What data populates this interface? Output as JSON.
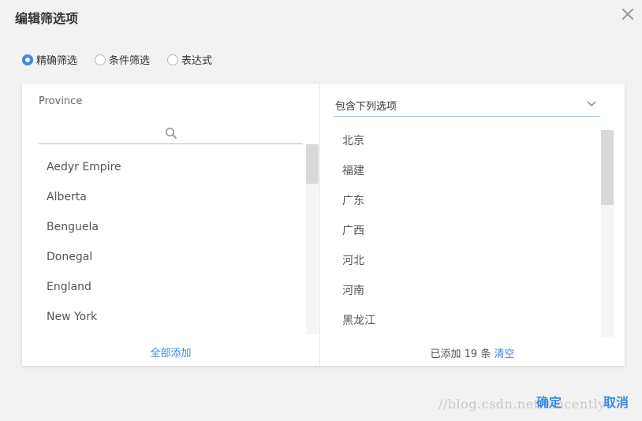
{
  "dialog": {
    "title": "编辑筛选项"
  },
  "modes": [
    {
      "label": "精确筛选",
      "checked": true
    },
    {
      "label": "条件筛选",
      "checked": false
    },
    {
      "label": "表达式",
      "checked": false
    }
  ],
  "left": {
    "field_label": "Province",
    "search_value": "",
    "items": [
      "Aedyr Empire",
      "Alberta",
      "Benguela",
      "Donegal",
      "England",
      "New York"
    ],
    "add_all": "全部添加"
  },
  "right": {
    "select_value": "包含下列选项",
    "items": [
      "北京",
      "福建",
      "广东",
      "广西",
      "河北",
      "河南",
      "黑龙江"
    ],
    "footer_prefix": "已添加 19 条",
    "clear": "清空"
  },
  "buttons": {
    "confirm": "确定",
    "cancel": "取消"
  },
  "watermark": "//blog.csdn.net/vincently",
  "colors": {
    "accent": "#3d88e0",
    "background": "#f2f2f2",
    "panel": "#ffffff"
  },
  "icons": [
    "close-icon",
    "search-icon",
    "chevron-down-icon"
  ]
}
